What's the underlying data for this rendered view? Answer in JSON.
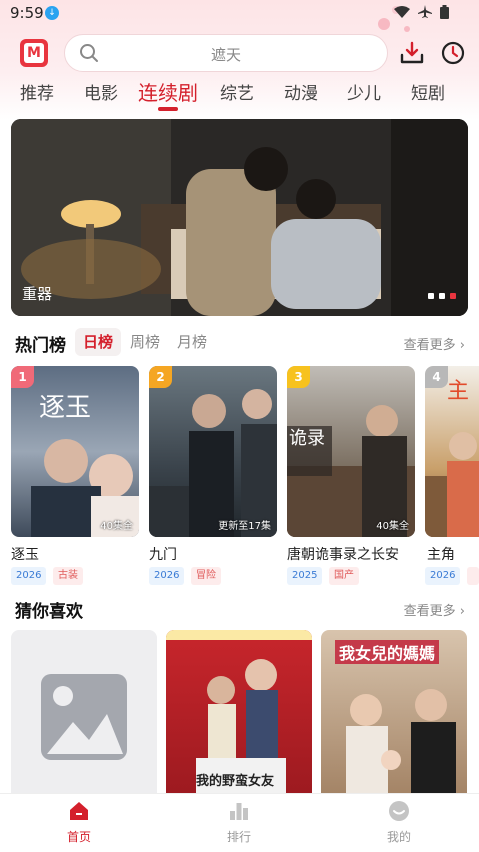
{
  "status": {
    "time": "9:59"
  },
  "search": {
    "placeholder": "遮天"
  },
  "tabs": [
    {
      "label": "推荐"
    },
    {
      "label": "电影"
    },
    {
      "label": "连续剧"
    },
    {
      "label": "综艺"
    },
    {
      "label": "动漫"
    },
    {
      "label": "少儿"
    },
    {
      "label": "短剧"
    }
  ],
  "banner": {
    "title": "重器",
    "slide_count": 3,
    "active_slide": 3
  },
  "hot": {
    "title": "热门榜",
    "segments": [
      {
        "label": "日榜"
      },
      {
        "label": "周榜"
      },
      {
        "label": "月榜"
      }
    ],
    "more": "查看更多",
    "items": [
      {
        "rank": "1",
        "name": "逐玉",
        "episodes": "40集全",
        "year": "2026",
        "genre": "古装",
        "rank_color": "#f06a78"
      },
      {
        "rank": "2",
        "name": "九门",
        "episodes": "更新至17集",
        "year": "2026",
        "genre": "冒险",
        "rank_color": "#f5a623"
      },
      {
        "rank": "3",
        "name": "唐朝诡事录之长安",
        "episodes": "40集全",
        "year": "2025",
        "genre": "国产",
        "rank_color": "#f7c21f"
      },
      {
        "rank": "4",
        "name": "主角",
        "episodes": "",
        "year": "2026",
        "genre": "",
        "rank_color": "#b8b8b8"
      }
    ]
  },
  "guess": {
    "title": "猜你喜欢",
    "more": "查看更多",
    "items": [
      {
        "poster_text": ""
      },
      {
        "poster_text": "我的野蛮女友"
      },
      {
        "poster_text": "我女兒的媽媽"
      }
    ]
  },
  "bottom_nav": [
    {
      "label": "首页",
      "icon": "home-icon"
    },
    {
      "label": "排行",
      "icon": "chart-icon"
    },
    {
      "label": "我的",
      "icon": "profile-icon"
    }
  ],
  "colors": {
    "accent": "#d4202c"
  }
}
